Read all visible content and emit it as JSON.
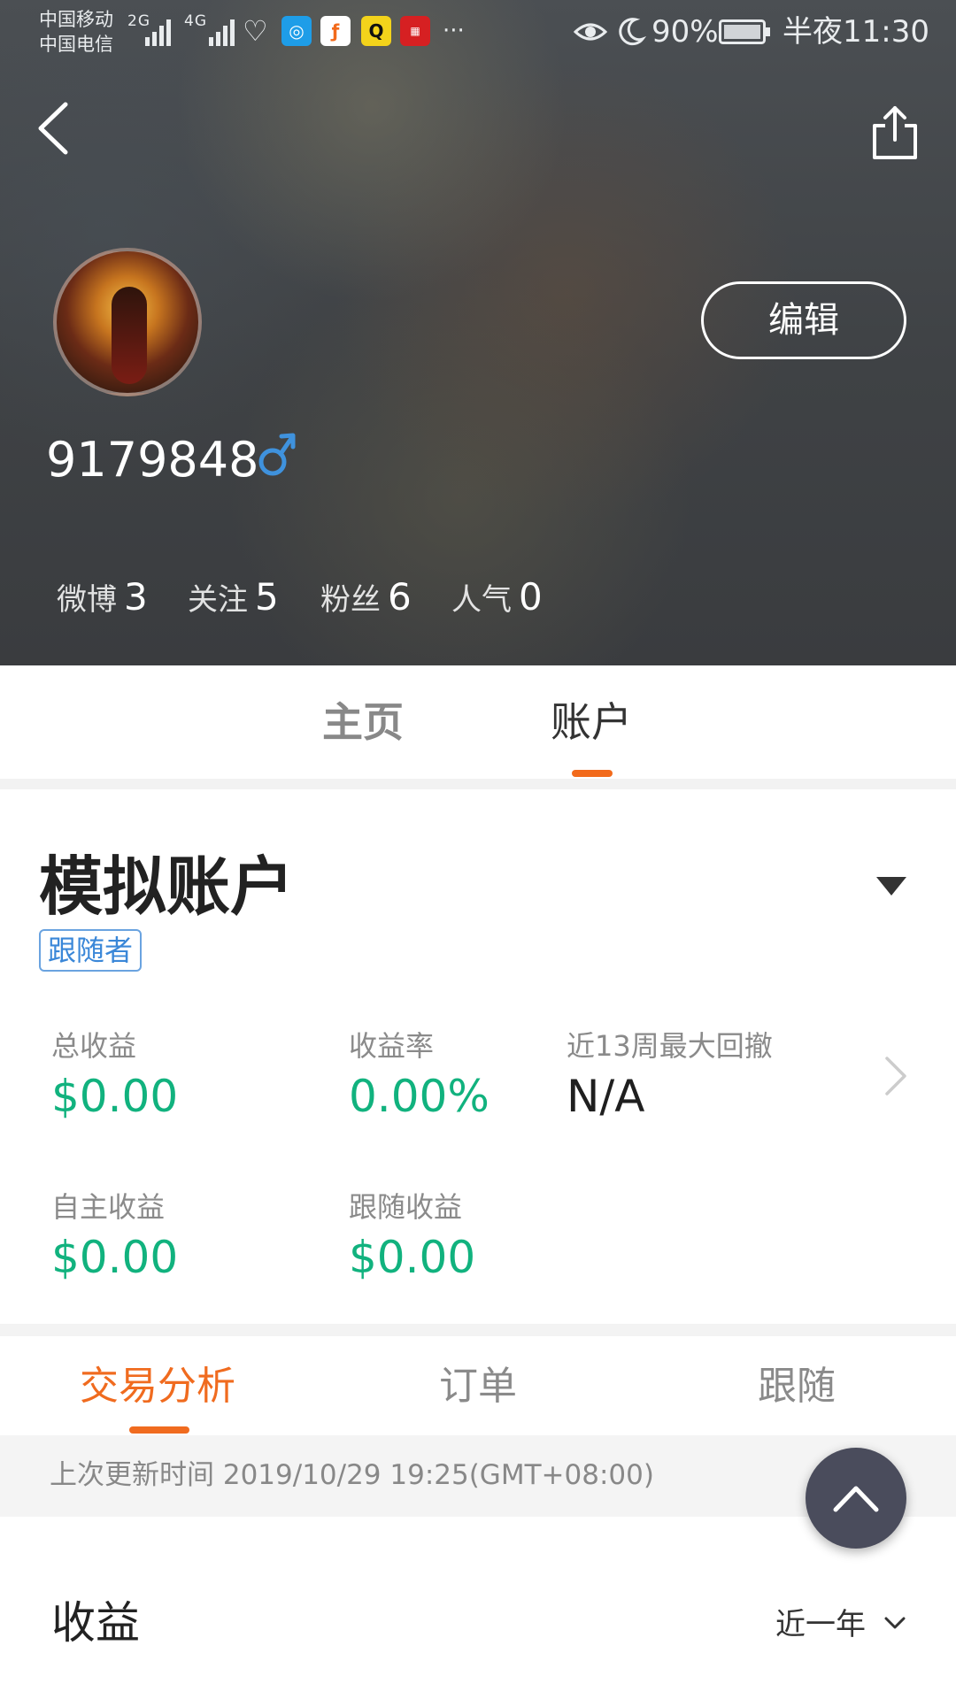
{
  "status_bar": {
    "carrier_1": "中国移动",
    "carrier_2": "中国电信",
    "net_1": "2G",
    "net_2": "4G",
    "more": "···",
    "battery": "90%",
    "time": "半夜11:30"
  },
  "header": {
    "back_icon": "chevron-left-icon",
    "share_icon": "share-icon"
  },
  "profile": {
    "username": "9179848",
    "gender_icon": "male-icon",
    "edit_label": "编辑",
    "stats": [
      {
        "label": "微博",
        "value": "3"
      },
      {
        "label": "关注",
        "value": "5"
      },
      {
        "label": "粉丝",
        "value": "6"
      },
      {
        "label": "人气",
        "value": "0"
      }
    ]
  },
  "profile_tabs": [
    {
      "label": "主页",
      "active": false
    },
    {
      "label": "账户",
      "active": true
    }
  ],
  "account": {
    "title": "模拟账户",
    "role_badge": "跟随者",
    "metrics": [
      {
        "label": "总收益",
        "value": "$0.00"
      },
      {
        "label": "收益率",
        "value": "0.00%"
      },
      {
        "label": "近13周最大回撤",
        "value": "N/A"
      },
      {
        "label": "自主收益",
        "value": "$0.00"
      },
      {
        "label": "跟随收益",
        "value": "$0.00"
      }
    ]
  },
  "sub_tabs": [
    {
      "label": "交易分析",
      "active": true
    },
    {
      "label": "订单",
      "active": false
    },
    {
      "label": "跟随",
      "active": false
    }
  ],
  "update_text": "上次更新时间 2019/10/29 19:25(GMT+08:00)",
  "income": {
    "title": "收益",
    "period": "近一年"
  },
  "colors": {
    "accent": "#f26a1b",
    "positive": "#11b27e",
    "badge_blue": "#3a87d8"
  }
}
